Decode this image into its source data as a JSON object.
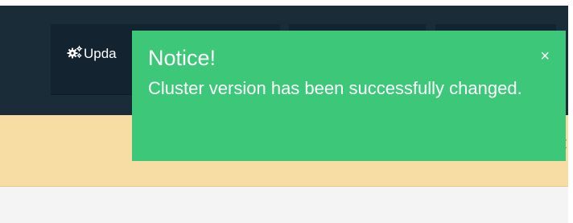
{
  "navbar": {
    "update_label": "Upda"
  },
  "notice": {
    "title": "Notice!",
    "message": "Cluster version has been successfully changed.",
    "close_glyph": "×"
  },
  "warning": {
    "close_glyph": "×"
  },
  "colors": {
    "navbar": "#1a2c38",
    "notice": "#3cc878",
    "warning": "#f7dca4"
  },
  "icons": {
    "update": "gears-icon"
  }
}
